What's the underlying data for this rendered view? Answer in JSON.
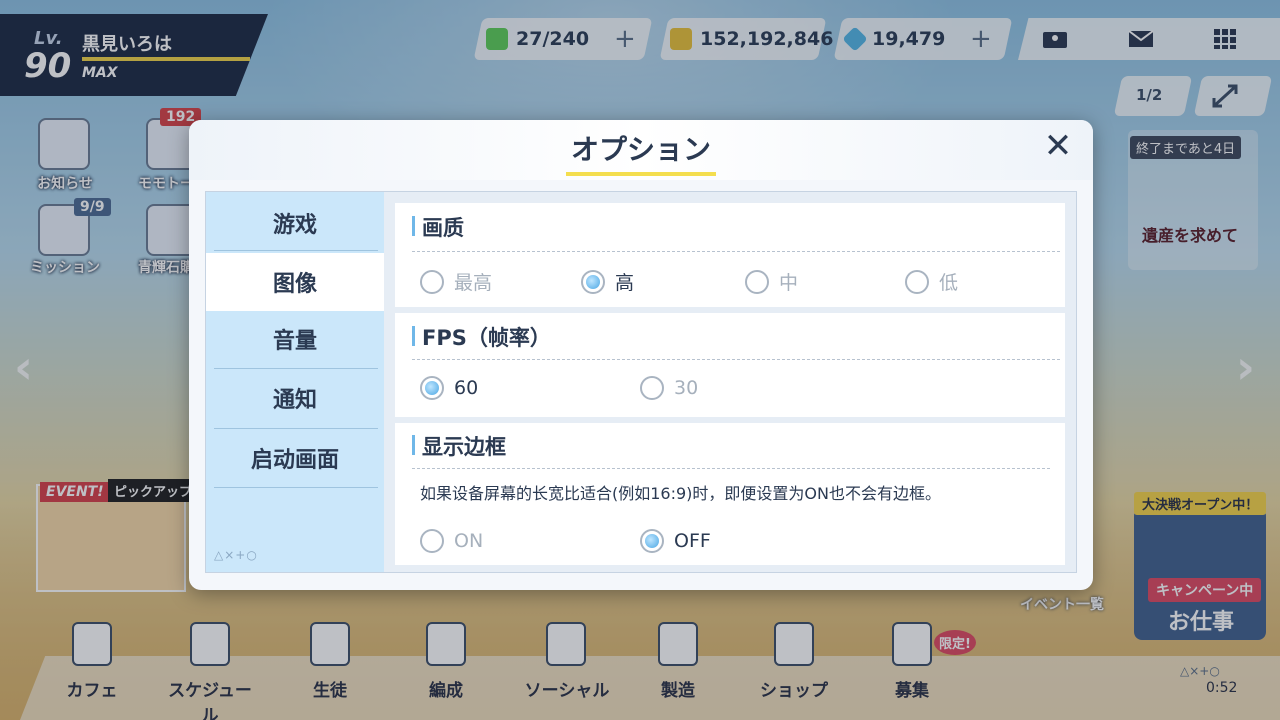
{
  "hud": {
    "level_label": "Lv.",
    "level": "90",
    "player_name": "黒見いろは",
    "level_status": "MAX",
    "ap": "27/240",
    "credits": "152,192,846",
    "gems": "19,479",
    "plus": "+",
    "speed_toggle": "1/2"
  },
  "left_menu": {
    "notice_label": "お知らせ",
    "momotalk_label": "モモトーク",
    "momotalk_badge": "192",
    "mission_label": "ミッション",
    "mission_badge": "9/9",
    "bluearchive_label": "青輝石購入"
  },
  "event_banner": {
    "event_tag": "EVENT!",
    "pickup_tag": "ピックアップ"
  },
  "right_banner": {
    "tag": "終了まであと4日",
    "title": "遺産を求めて"
  },
  "campaign": {
    "top_label": "大決戦オープン中！",
    "tag": "キャンペーン中",
    "label": "お仕事",
    "event_list": "イベント一覧"
  },
  "bottom_nav": {
    "items": [
      "カフェ",
      "スケジュール",
      "生徒",
      "編成",
      "ソーシャル",
      "製造",
      "ショップ",
      "募集"
    ],
    "limited_badge": "限定!",
    "time": "0:52",
    "symbols": "△×+○"
  },
  "dialog": {
    "title": "オプション",
    "close": "✕",
    "tabs": [
      "游戏",
      "图像",
      "音量",
      "通知",
      "启动画面"
    ],
    "active_tab": "图像",
    "tab_deco": "△×+○",
    "sections": {
      "quality": {
        "title": "画质",
        "options": [
          "最高",
          "高",
          "中",
          "低"
        ],
        "selected": "高"
      },
      "fps": {
        "title": "FPS（帧率）",
        "options": [
          "60",
          "30"
        ],
        "selected": "60"
      },
      "border": {
        "title": "显示边框",
        "description": "如果设备屏幕的长宽比适合(例如16:9)时，即便设置为ON也不会有边框。",
        "options": [
          "ON",
          "OFF"
        ],
        "selected": "OFF"
      }
    }
  },
  "colors": {
    "accent_blue": "#4aa6e3",
    "tab_bg": "#cbe7fa",
    "underline_yellow": "#f4de4e",
    "hud_navy": "#1e2c45"
  }
}
